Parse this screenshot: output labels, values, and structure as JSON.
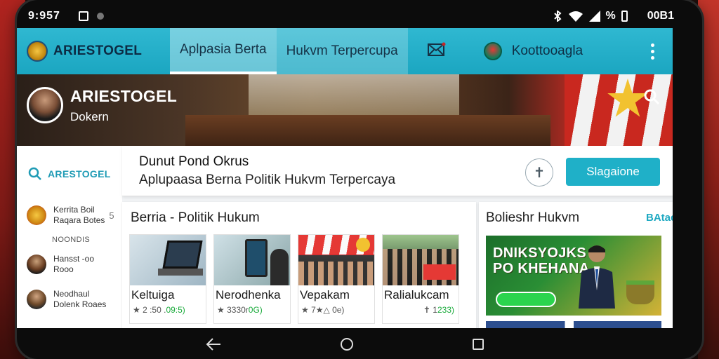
{
  "status_bar": {
    "time": "9:957",
    "battery_text": "%",
    "right_text": "00B1"
  },
  "appbar": {
    "brand": "ARIESTOGEL",
    "tabs": [
      {
        "label": "Aplpasia Berta",
        "active": true
      },
      {
        "label": "Hukvm Terpercupa",
        "active": false
      }
    ],
    "account_name": "Koottooagla",
    "accent_color": "#1ba6c1"
  },
  "hero": {
    "title": "ARIESTOGEL",
    "subtitle": "Dokern"
  },
  "sidebar": {
    "search_brand": "ARESTOGEL",
    "items": [
      {
        "line1": "Kerrita Boil",
        "line2": "Raqara Botes",
        "extra": "5"
      },
      {
        "line1": "Hansst -oo",
        "line2": "Rooo"
      },
      {
        "line1": "Neodhaul",
        "line2": "Dolenk Roaes"
      }
    ],
    "separator": "NOONDIS"
  },
  "header_card": {
    "title": "Dunut Pond Okrus",
    "subtitle": "Aplupaasa Berna Politik Hukvm Terpercaya",
    "button_label": "Slagaione"
  },
  "news": {
    "title": "Berria - Politik Hukum",
    "cards": [
      {
        "title": "Keltuiga",
        "meta": "★ 2 :50 .",
        "highlight": "09:5)"
      },
      {
        "title": "Nerodhenka",
        "meta": "★ 3330r",
        "highlight": "0G)"
      },
      {
        "title": "Vepakam",
        "meta": "★ 7★△ 0e)",
        "highlight": ""
      },
      {
        "title": "Ralialukcam",
        "meta": "✝ 1",
        "highlight": "233)"
      }
    ]
  },
  "right_panel": {
    "title": "Bolieshr Hukvm",
    "link": "BAtac",
    "promo_headline_1": "DNIKSYOJKS",
    "promo_headline_2": "PO KHEHANA"
  },
  "icons": {
    "brand_logo": "brand-logo-icon",
    "mail": "mail-icon",
    "more": "more-vert-icon",
    "search": "search-icon",
    "pin": "pin-icon",
    "back": "back-icon",
    "home": "home-icon",
    "recent": "recent-apps-icon"
  }
}
